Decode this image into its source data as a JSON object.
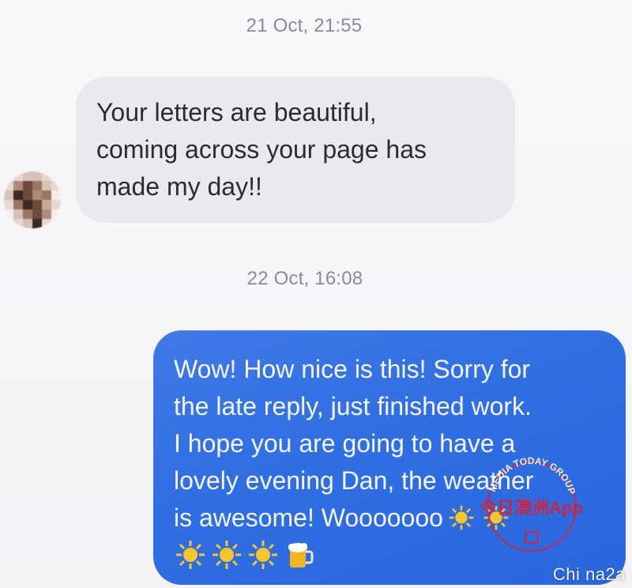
{
  "conversation": {
    "messages": [
      {
        "timestamp": "21 Oct, 21:55",
        "direction": "incoming",
        "text": "Your letters are beautiful,\ncoming across your page has\nmade my day!!"
      },
      {
        "timestamp": "22 Oct, 16:08",
        "direction": "outgoing",
        "text": "Wow! How nice is this! Sorry for\nthe late reply, just finished work.\nI hope you are going to have a\nlovely evening Dan, the weather\nis awesome! Wooooooo",
        "emoji_inline": [
          "sun-emoji",
          "sun-emoji"
        ],
        "emoji_row": [
          "sun-emoji",
          "sun-emoji",
          "sun-emoji",
          "beer-emoji"
        ]
      }
    ]
  },
  "watermarks": {
    "stamp_text": "今日澳洲App",
    "stamp_ring_text": "MEDIA TODAY GROUP",
    "corner_text": "Chi na2a"
  },
  "colors": {
    "incoming_bubble": "#ebe8ee",
    "outgoing_bubble": "#2f6ee3",
    "timestamp": "#8e8c93",
    "watermark_red": "#dc1e32"
  }
}
